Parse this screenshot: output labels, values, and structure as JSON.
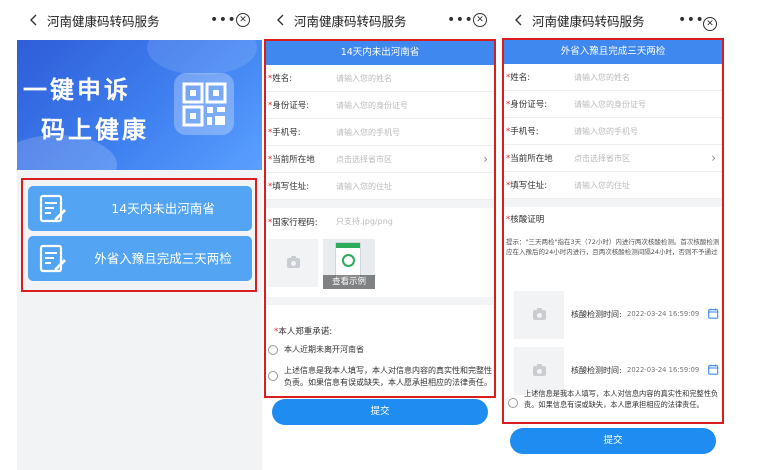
{
  "app_title": "河南健康码转码服务",
  "nav": {
    "more": "•••",
    "close": "⊗"
  },
  "home": {
    "banner_line1": "一键申诉",
    "banner_line2": "码上健康",
    "option1": "14天内未出河南省",
    "option2": "外省入豫且完成三天两检"
  },
  "form_14": {
    "header": "14天内未出河南省",
    "fields": [
      {
        "label": "姓名:",
        "placeholder": "请输入您的姓名"
      },
      {
        "label": "身份证号:",
        "placeholder": "请输入您的身份证号"
      },
      {
        "label": "手机号:",
        "placeholder": "请输入您的手机号"
      },
      {
        "label": "当前所在地",
        "placeholder": "点击选择省市区"
      },
      {
        "label": "填写住址:",
        "placeholder": "请输入您的住址"
      }
    ],
    "travel_code_label": "国家行程码:",
    "travel_code_hint": "只支持.jpg/png",
    "sample_caption": "查看示例",
    "promise_title": "本人郑重承诺:",
    "promise_option1": "本人近期未离开河南省",
    "promise_option2": "上述信息是我本人填写，本人对信息内容的真实性和完整性负责。如果信息有误或缺失，本人愿承担相应的法律责任。",
    "submit": "提交"
  },
  "form_wsr": {
    "header": "外省入豫且完成三天两检",
    "fields": [
      {
        "label": "姓名:",
        "placeholder": "请输入您的姓名"
      },
      {
        "label": "身份证号:",
        "placeholder": "请输入您的身份证号"
      },
      {
        "label": "手机号:",
        "placeholder": "请输入您的手机号"
      },
      {
        "label": "当前所在地",
        "placeholder": "点击选择省市区"
      },
      {
        "label": "填写住址:",
        "placeholder": "请输入您的住址"
      }
    ],
    "nucleic_title": "核酸证明",
    "hint": "提示：\"三天两检\"指在3天（72小时）内进行两次核酸检测。首次核酸检测应在入豫后的24小时内进行，且两次核酸检测间隔24小时，否则不予通过",
    "tests": [
      {
        "label": "核酸检测时间:",
        "time": "2022-03-24 16:59:09"
      },
      {
        "label": "核酸检测时间:",
        "time": "2022-03-24 16:59:09"
      }
    ],
    "declaration": "上述信息是我本人填写，本人对信息内容的真实性和完整性负责。如果信息有误或缺失，本人愿承担相应的法律责任。",
    "submit": "提交"
  },
  "colors": {
    "brand_blue": "#3e88ef",
    "option_blue": "#53a5f3",
    "submit_blue": "#1e8cf0",
    "highlight_red": "#d81e1e",
    "required_red": "#e23030"
  }
}
